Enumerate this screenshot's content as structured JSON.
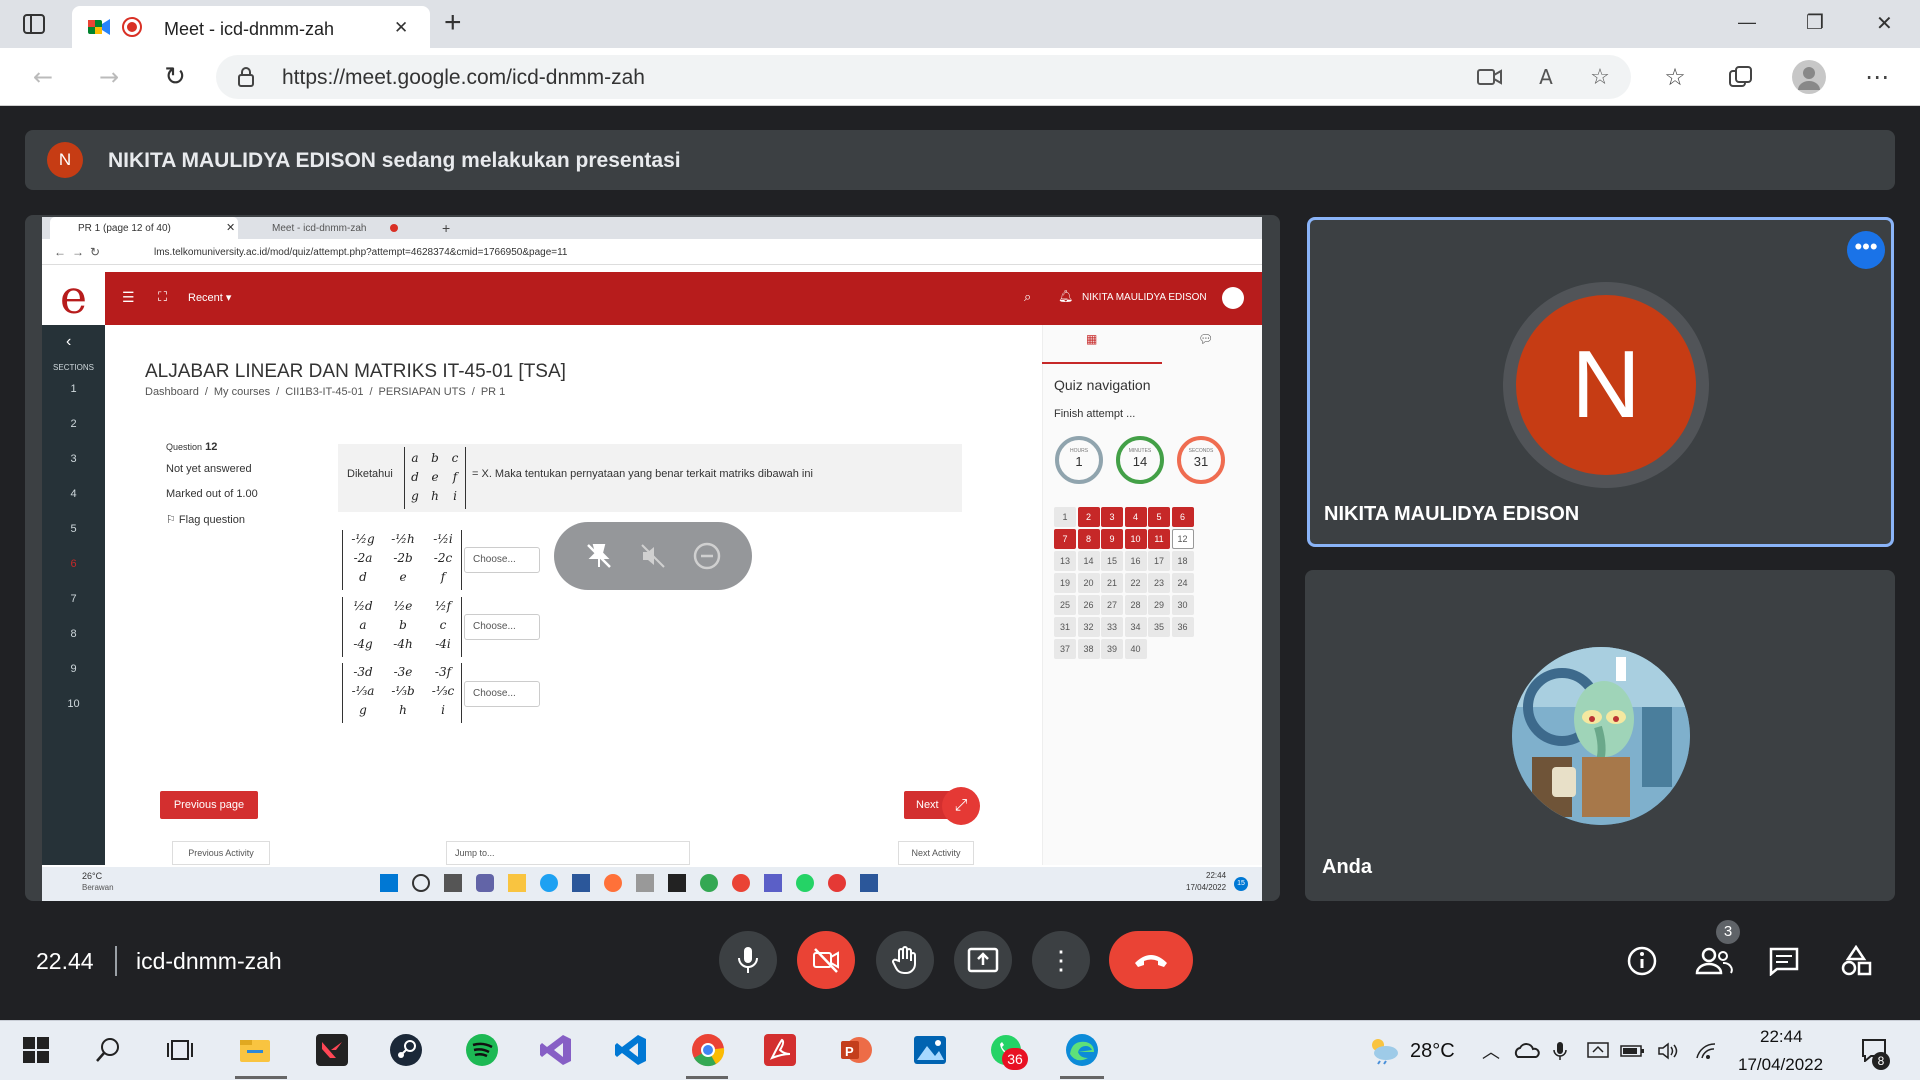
{
  "browser": {
    "tab_title": "Meet - icd-dnmm-zah",
    "url": "https://meet.google.com/icd-dnmm-zah",
    "new_tab": "+",
    "minimize": "—",
    "maximize": "❐",
    "close": "✕"
  },
  "meet": {
    "presenter_banner": {
      "avatar_letter": "N",
      "text": "NIKITA MAULIDYA EDISON sedang melakukan presentasi"
    },
    "participants": [
      {
        "name": "NIKITA MAULIDYA EDISON",
        "avatar_letter": "N",
        "avatar_color": "#c63c14"
      },
      {
        "name": "Anda"
      }
    ],
    "bottom_bar": {
      "time": "22.44",
      "meeting_code": "icd-dnmm-zah",
      "people_count": "3"
    },
    "colors": {
      "accent": "#8ab4f8",
      "end_call": "#ea4335",
      "tile_bg": "#3c4043"
    }
  },
  "shared_screen": {
    "tabs": [
      {
        "label": "PR 1 (page 12 of 40)"
      },
      {
        "label": "Meet - icd-dnmm-zah"
      }
    ],
    "url": "lms.telkomuniversity.ac.id/mod/quiz/attempt.php?attempt=4628374&cmid=1766950&page=11",
    "topbar": {
      "recent": "Recent ▾",
      "user": "NIKITA MAULIDYA EDISON"
    },
    "sections_label": "SECTIONS",
    "section_numbers": [
      "1",
      "2",
      "3",
      "4",
      "5",
      "6",
      "7",
      "8",
      "9",
      "10"
    ],
    "course_title": "ALJABAR LINEAR DAN MATRIKS IT-45-01 [TSA]",
    "breadcrumb": [
      "Dashboard",
      "My courses",
      "CII1B3-IT-45-01",
      "PERSIAPAN UTS",
      "PR 1"
    ],
    "question": {
      "label": "Question",
      "number": "12",
      "status": "Not yet answered",
      "marks": "Marked out of 1.00",
      "flag": "Flag question",
      "prompt_prefix": "Diketahui",
      "prompt_matrix": [
        [
          "a",
          "b",
          "c"
        ],
        [
          "d",
          "e",
          "f"
        ],
        [
          "g",
          "h",
          "i"
        ]
      ],
      "prompt_suffix": "= X. Maka tentukan pernyataan yang benar terkait matriks dibawah ini",
      "options": [
        {
          "rows": [
            [
              "-½g",
              "-½h",
              "-½i"
            ],
            [
              "-2a",
              "-2b",
              "-2c"
            ],
            [
              "d",
              "e",
              "f"
            ]
          ],
          "select": "Choose..."
        },
        {
          "rows": [
            [
              "½d",
              "½e",
              "½f"
            ],
            [
              "a",
              "b",
              "c"
            ],
            [
              "-4g",
              "-4h",
              "-4i"
            ]
          ],
          "select": "Choose..."
        },
        {
          "rows": [
            [
              "-3d",
              "-3e",
              "-3f"
            ],
            [
              "-⅓a",
              "-⅓b",
              "-⅓c"
            ],
            [
              "g",
              "h",
              "i"
            ]
          ],
          "select": "Choose..."
        }
      ]
    },
    "buttons": {
      "previous": "Previous page",
      "next": "Next",
      "prev_activity": "Previous Activity",
      "jump_to": "Jump to...",
      "next_activity": "Next Activity"
    },
    "quiz_nav": {
      "title": "Quiz navigation",
      "finish": "Finish attempt ...",
      "timer": [
        {
          "label": "HOURS",
          "value": "1"
        },
        {
          "label": "MINUTES",
          "value": "14"
        },
        {
          "label": "SECONDS",
          "value": "31"
        }
      ],
      "answered": [
        2,
        3,
        4,
        5,
        6,
        7,
        8,
        9,
        10,
        11
      ],
      "total": 40
    },
    "taskbar": {
      "weather_temp": "26°C",
      "weather_desc": "Berawan",
      "time": "22:44",
      "date": "17/04/2022",
      "badge": "15"
    }
  },
  "windows_taskbar": {
    "weather": "28°C",
    "time": "22:44",
    "date": "17/04/2022",
    "whatsapp_badge": "36",
    "notification_badge": "8"
  }
}
